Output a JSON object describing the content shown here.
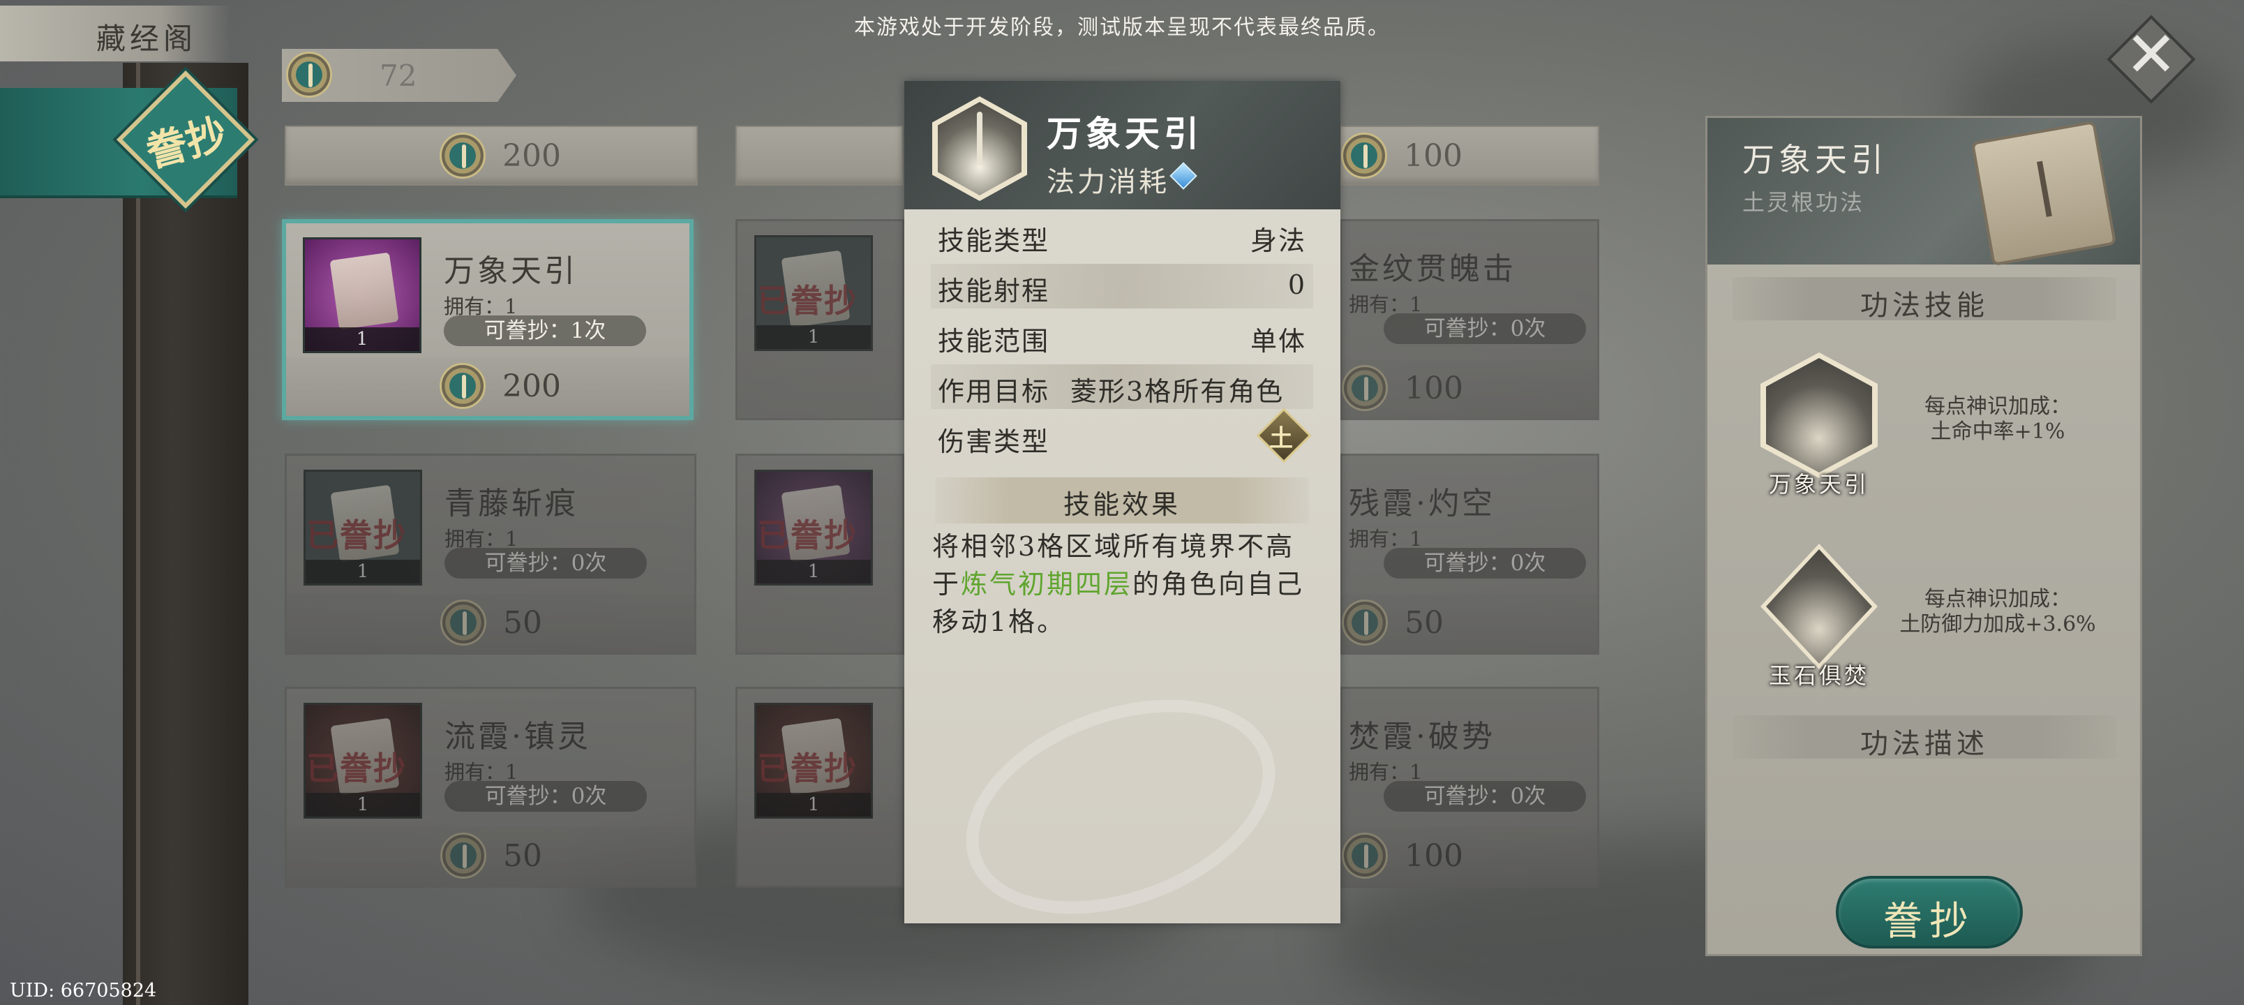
{
  "notice": "本游戏处于开发阶段，测试版本呈现不代表最终品质。",
  "left_rail": {
    "title": "藏经阁",
    "tab_label": "誊抄",
    "uid": "UID: 66705824"
  },
  "currency": {
    "amount": "72",
    "icon": "spirit-coin-icon"
  },
  "grid": {
    "top_bars": [
      {
        "price": "200"
      },
      {
        "price": ""
      },
      {
        "price": "100"
      }
    ],
    "cards": [
      {
        "name": "万象天引",
        "owned": "拥有：1",
        "copies": "可誊抄：1次",
        "count": "1",
        "price": "200",
        "stamp": "",
        "selected": true
      },
      {
        "name": "",
        "owned": "",
        "copies": "",
        "count": "1",
        "price": "",
        "stamp": "已誊抄"
      },
      {
        "name": "金纹贯魄击",
        "owned": "拥有：1",
        "copies": "可誊抄：0次",
        "count": "",
        "price": "100",
        "stamp": ""
      },
      {
        "name": "青藤斩痕",
        "owned": "拥有：1",
        "copies": "可誊抄：0次",
        "count": "1",
        "price": "50",
        "stamp": "已誊抄"
      },
      {
        "name": "",
        "owned": "",
        "copies": "",
        "count": "1",
        "price": "",
        "stamp": "已誊抄"
      },
      {
        "name": "残霞·灼空",
        "owned": "拥有：1",
        "copies": "可誊抄：0次",
        "count": "",
        "price": "50",
        "stamp": ""
      },
      {
        "name": "流霞·镇灵",
        "owned": "拥有：1",
        "copies": "可誊抄：0次",
        "count": "1",
        "price": "50",
        "stamp": "已誊抄"
      },
      {
        "name": "",
        "owned": "",
        "copies": "",
        "count": "1",
        "price": "",
        "stamp": "已誊抄"
      },
      {
        "name": "焚霞·破势",
        "owned": "拥有：1",
        "copies": "可誊抄：0次",
        "count": "",
        "price": "100",
        "stamp": ""
      }
    ]
  },
  "tooltip": {
    "title": "万象天引",
    "mana_label": "法力消耗",
    "rows": [
      {
        "key": "技能类型",
        "value": "身法"
      },
      {
        "key": "技能射程",
        "value": "0"
      },
      {
        "key": "技能范围",
        "value": "单体"
      },
      {
        "key": "作用目标",
        "value": "菱形3格所有角色"
      },
      {
        "key": "伤害类型",
        "value": "",
        "element_glyph": "土"
      }
    ],
    "effect_header": "技能效果",
    "desc_pre": "将相邻3格区域所有境界不高于",
    "desc_highlight": "炼气初期四层",
    "desc_post": "的角色向自己移动1格。",
    "highlight_color": "#5fa52e"
  },
  "right_panel": {
    "title": "万象天引",
    "subtitle": "土灵根功法",
    "skills_header": "功法技能",
    "skills": [
      {
        "name": "万象天引",
        "desc_line1": "每点神识加成：",
        "desc_line2": "土命中率+1%"
      },
      {
        "name": "玉石俱焚",
        "desc_line1": "每点神识加成：",
        "desc_line2": "土防御力加成+3.6%"
      }
    ],
    "desc_header": "功法描述",
    "copy_button": "誊抄"
  },
  "colors": {
    "accent_teal": "#2b7a70",
    "gold": "#d5c58d",
    "stamp_red": "#b8262d"
  }
}
